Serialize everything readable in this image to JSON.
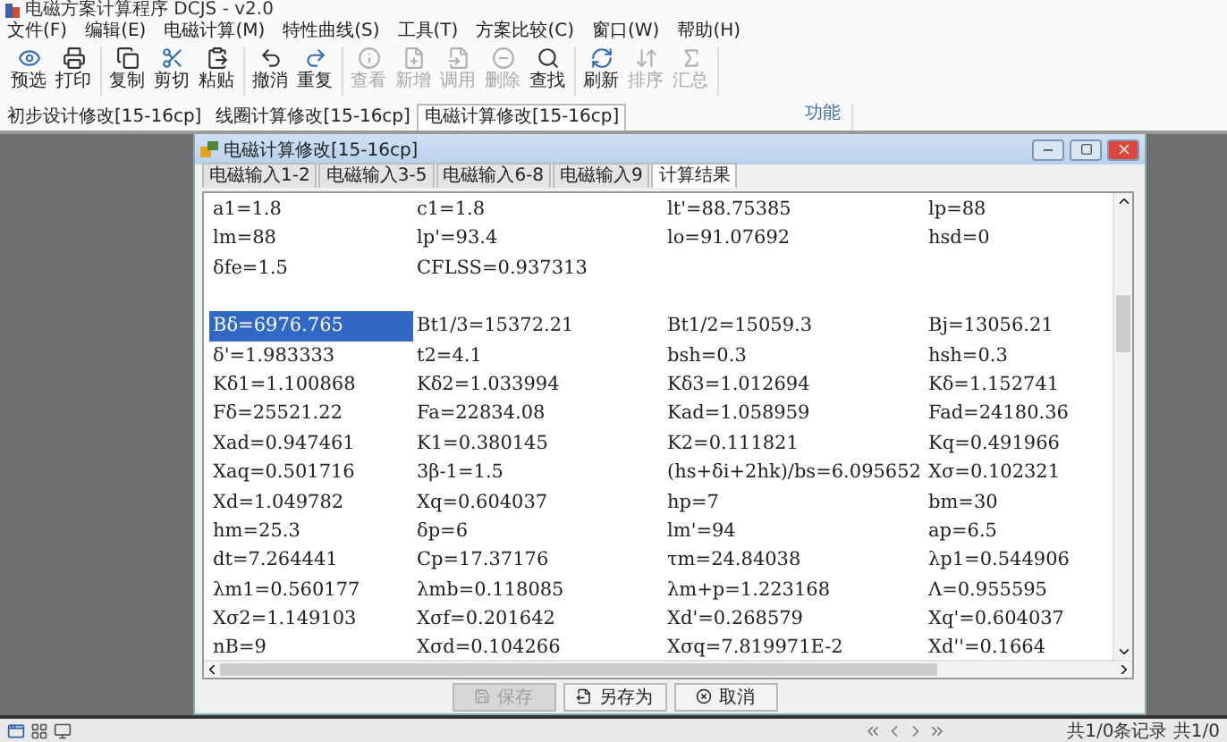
{
  "window": {
    "title": "电磁方案计算程序 DCJS - v2.0"
  },
  "menu": [
    "文件(F)",
    "编辑(E)",
    "电磁计算(M)",
    "特性曲线(S)",
    "工具(T)",
    "方案比较(C)",
    "窗口(W)",
    "帮助(H)"
  ],
  "toolbar": {
    "group_label": "功能",
    "groups": [
      [
        {
          "label": "预选",
          "disabled": false
        },
        {
          "label": "打印",
          "disabled": false
        }
      ],
      [
        {
          "label": "复制",
          "disabled": false
        },
        {
          "label": "剪切",
          "disabled": false
        },
        {
          "label": "粘贴",
          "disabled": false
        }
      ],
      [
        {
          "label": "撤消",
          "disabled": false
        },
        {
          "label": "重复",
          "disabled": false
        }
      ],
      [
        {
          "label": "查看",
          "disabled": true
        },
        {
          "label": "新增",
          "disabled": true
        },
        {
          "label": "调用",
          "disabled": true
        },
        {
          "label": "删除",
          "disabled": true
        },
        {
          "label": "查找",
          "disabled": false
        }
      ],
      [
        {
          "label": "刷新",
          "disabled": false
        },
        {
          "label": "排序",
          "disabled": true
        },
        {
          "label": "汇总",
          "disabled": true
        }
      ]
    ]
  },
  "documents": [
    {
      "label": "初步设计修改[15-16cp]",
      "selected": false
    },
    {
      "label": "线圈计算修改[15-16cp]",
      "selected": false
    },
    {
      "label": "电磁计算修改[15-16cp]",
      "selected": true
    }
  ],
  "child_window": {
    "title": "电磁计算修改[15-16cp]",
    "tabs": [
      {
        "label": "电磁输入1-2",
        "selected": false
      },
      {
        "label": "电磁输入3-5",
        "selected": false
      },
      {
        "label": "电磁输入6-8",
        "selected": false
      },
      {
        "label": "电磁输入9",
        "selected": false
      },
      {
        "label": "计算结果",
        "selected": true
      }
    ],
    "results": [
      {
        "rows": [
          [
            {
              "text": "a1=1.8",
              "selected": false
            },
            {
              "text": "c1=1.8",
              "selected": false
            },
            {
              "text": "lt'=88.75385",
              "selected": false
            },
            {
              "text": "lp=88",
              "selected": false
            }
          ],
          [
            {
              "text": "lm=88",
              "selected": false
            },
            {
              "text": "lp'=93.4",
              "selected": false
            },
            {
              "text": "lo=91.07692",
              "selected": false
            },
            {
              "text": "hsd=0",
              "selected": false
            }
          ],
          [
            {
              "text": "δfe=1.5",
              "selected": false
            },
            {
              "text": "CFLSS=0.937313",
              "selected": false
            }
          ]
        ]
      },
      {
        "rows": [
          [
            {
              "text": "Bδ=6976.765",
              "selected": true
            },
            {
              "text": "Bt1/3=15372.21",
              "selected": false
            },
            {
              "text": "Bt1/2=15059.3",
              "selected": false
            },
            {
              "text": "Bj=13056.21",
              "selected": false
            }
          ],
          [
            {
              "text": "δ'=1.983333",
              "selected": false
            },
            {
              "text": "t2=4.1",
              "selected": false
            },
            {
              "text": "bsh=0.3",
              "selected": false
            },
            {
              "text": "hsh=0.3",
              "selected": false
            }
          ],
          [
            {
              "text": "Kδ1=1.100868",
              "selected": false
            },
            {
              "text": "Kδ2=1.033994",
              "selected": false
            },
            {
              "text": "Kδ3=1.012694",
              "selected": false
            },
            {
              "text": "Kδ=1.152741",
              "selected": false
            }
          ],
          [
            {
              "text": "Fδ=25521.22",
              "selected": false
            },
            {
              "text": "Fa=22834.08",
              "selected": false
            },
            {
              "text": "Kad=1.058959",
              "selected": false
            },
            {
              "text": "Fad=24180.36",
              "selected": false
            }
          ],
          [
            {
              "text": "Xad=0.947461",
              "selected": false
            },
            {
              "text": "K1=0.380145",
              "selected": false
            },
            {
              "text": "K2=0.111821",
              "selected": false
            },
            {
              "text": "Kq=0.491966",
              "selected": false
            }
          ],
          [
            {
              "text": "Xaq=0.501716",
              "selected": false
            },
            {
              "text": "3β-1=1.5",
              "selected": false
            },
            {
              "text": "(hs+δi+2hk)/bs=6.095652",
              "selected": false
            },
            {
              "text": "Xσ=0.102321",
              "selected": false
            }
          ],
          [
            {
              "text": "Xd=1.049782",
              "selected": false
            },
            {
              "text": "Xq=0.604037",
              "selected": false
            },
            {
              "text": "hp=7",
              "selected": false
            },
            {
              "text": "bm=30",
              "selected": false
            }
          ],
          [
            {
              "text": "hm=25.3",
              "selected": false
            },
            {
              "text": "δp=6",
              "selected": false
            },
            {
              "text": "lm'=94",
              "selected": false
            },
            {
              "text": "ap=6.5",
              "selected": false
            }
          ],
          [
            {
              "text": "dt=7.264441",
              "selected": false
            },
            {
              "text": "Cp=17.37176",
              "selected": false
            },
            {
              "text": "τm=24.84038",
              "selected": false
            },
            {
              "text": "λp1=0.544906",
              "selected": false
            }
          ],
          [
            {
              "text": "λm1=0.560177",
              "selected": false
            },
            {
              "text": "λmb=0.118085",
              "selected": false
            },
            {
              "text": "λm+p=1.223168",
              "selected": false
            },
            {
              "text": "Λ=0.955595",
              "selected": false
            }
          ],
          [
            {
              "text": "Xσ2=1.149103",
              "selected": false
            },
            {
              "text": "Xσf=0.201642",
              "selected": false
            },
            {
              "text": "Xd'=0.268579",
              "selected": false
            },
            {
              "text": "Xq'=0.604037",
              "selected": false
            }
          ],
          [
            {
              "text": "nB=9",
              "selected": false
            },
            {
              "text": "Xσd=0.104266",
              "selected": false
            },
            {
              "text": "Xσq=7.819971E-2",
              "selected": false
            },
            {
              "text": "Xd''=0.1664",
              "selected": false
            }
          ]
        ]
      }
    ],
    "buttons": [
      {
        "label": "保存",
        "disabled": true
      },
      {
        "label": "另存为",
        "disabled": false
      },
      {
        "label": "取消",
        "disabled": false
      }
    ]
  },
  "status_bar": {
    "records": "共1/0条记录 共1/0"
  }
}
